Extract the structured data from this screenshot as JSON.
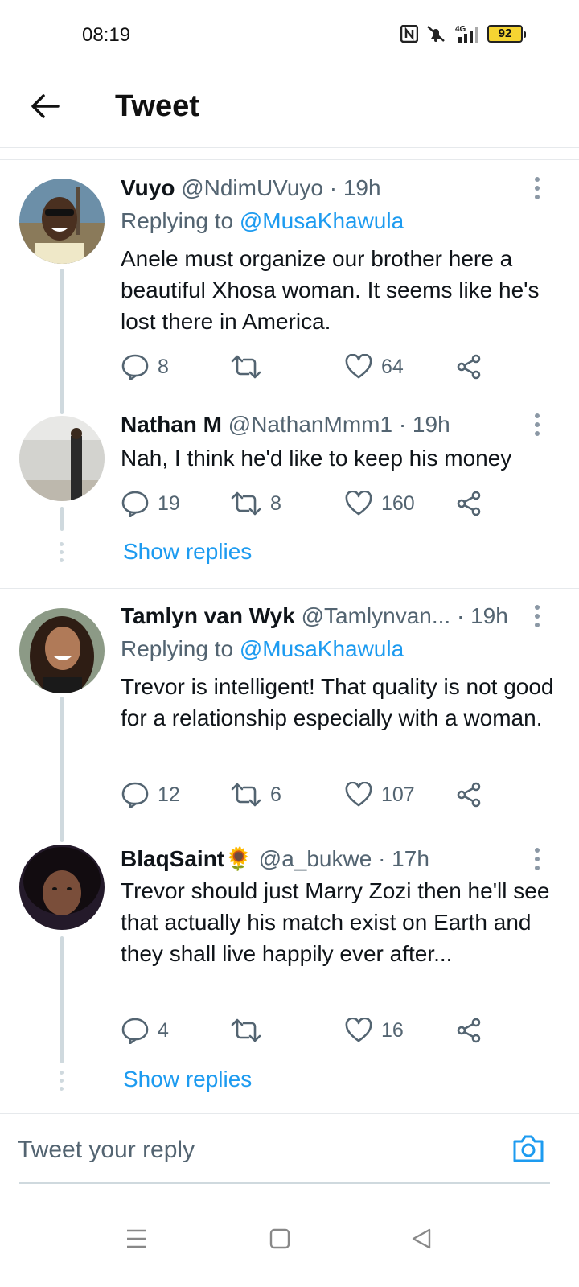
{
  "status_bar": {
    "time": "08:19",
    "network": "4G",
    "battery": "92",
    "battery_color": "#f5d432"
  },
  "header": {
    "back_icon": "arrow-left-icon",
    "title": "Tweet"
  },
  "tweets": [
    {
      "name": "Vuyo",
      "handle": "@NdimUVuyo",
      "time": "· 19h",
      "replying_prefix": "Replying to",
      "replying_to": "@MusaKhawula",
      "text": "Anele must organize our brother here a beautiful Xhosa woman. It seems like he's lost there in America.",
      "replies": "8",
      "retweets": "",
      "likes": "64"
    },
    {
      "name": "Nathan M",
      "handle": "@NathanMmm1",
      "time": "· 19h",
      "text": "Nah, I think he'd like to keep his money",
      "replies": "19",
      "retweets": "8",
      "likes": "160"
    },
    {
      "name": "Tamlyn van Wyk",
      "handle": "@Tamlynvan...",
      "time": "· 19h",
      "replying_prefix": "Replying to",
      "replying_to": "@MusaKhawula",
      "text": "Trevor is intelligent! That quality is not good for a relationship especially with a woman.",
      "replies": "12",
      "retweets": "6",
      "likes": "107"
    },
    {
      "name": "BlaqSaint🌻",
      "handle": "@a_bukwe",
      "time": "· 17h",
      "text": "Trevor should just Marry Zozi then he'll see that actually his match exist on Earth and they shall live happily ever after...",
      "replies": "4",
      "retweets": "",
      "likes": "16"
    }
  ],
  "show_replies_label": "Show replies",
  "reply_bar": {
    "placeholder": "Tweet your reply",
    "camera_icon": "camera-icon"
  },
  "colors": {
    "accent": "#1d9bf0",
    "secondary_text": "#536471",
    "thread_line": "#cfd9de"
  }
}
